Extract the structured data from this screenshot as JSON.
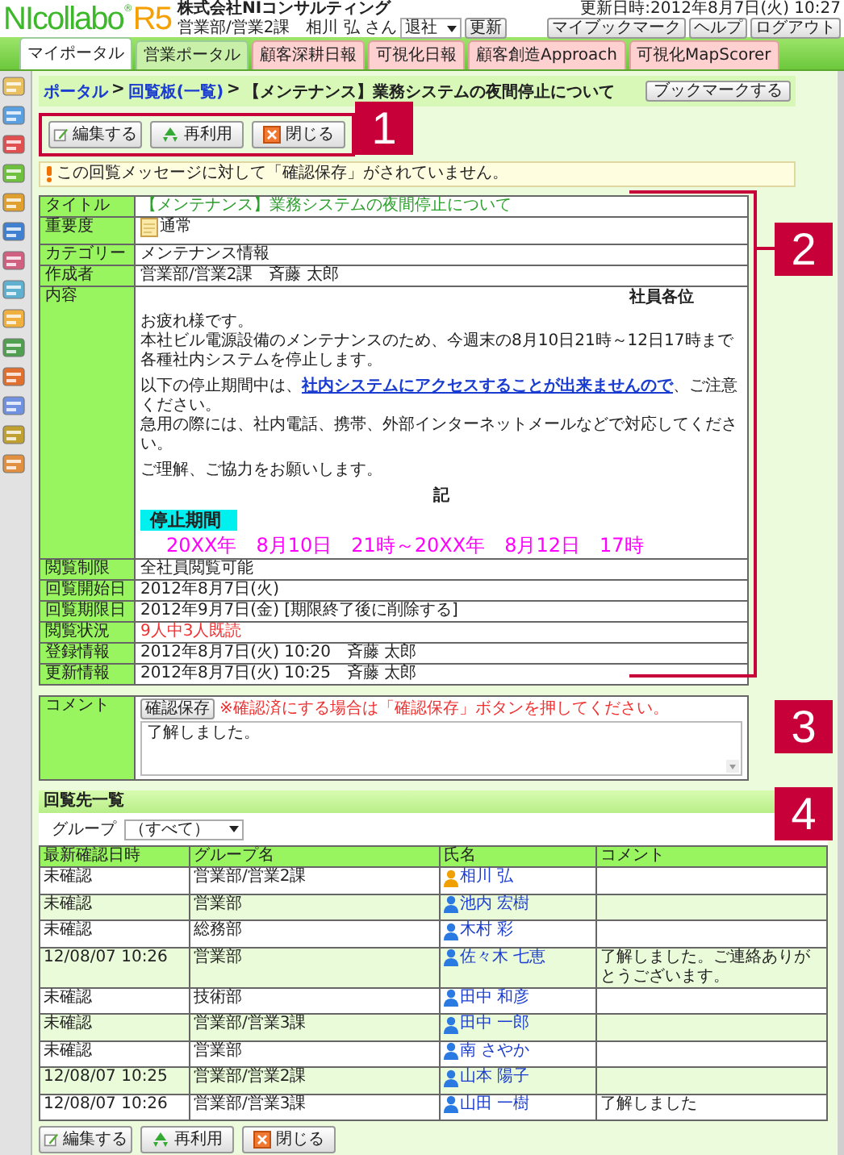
{
  "header": {
    "logo": "NIcollabo",
    "logo_mark": "®",
    "logo_suffix": "R5",
    "company": "株式会社NIコンサルティング",
    "user": "営業部/営業2課　相川 弘 さん",
    "status_select": "退社",
    "update_button": "更新",
    "updated": "更新日時:2012年8月7日(火) 10:27",
    "buttons": [
      "マイブックマーク",
      "ヘルプ",
      "ログアウト"
    ]
  },
  "tabs": [
    {
      "label": "マイポータル",
      "selected": true,
      "kind": "portal"
    },
    {
      "label": "営業ポータル",
      "selected": false,
      "kind": "portal"
    },
    {
      "label": "顧客深耕日報",
      "selected": false,
      "kind": "addon"
    },
    {
      "label": "可視化日報",
      "selected": false,
      "kind": "addon"
    },
    {
      "label": "顧客創造Approach",
      "selected": false,
      "kind": "addon"
    },
    {
      "label": "可視化MapScorer",
      "selected": false,
      "kind": "addon"
    }
  ],
  "breadcrumb": {
    "separator": ">",
    "items": [
      {
        "text": "ポータル",
        "link": true
      },
      {
        "text": "回覧板(一覧)",
        "link": true
      },
      {
        "text": "【メンテナンス】業務システムの夜間停止について",
        "link": false
      }
    ],
    "bookmark_button": "ブックマークする"
  },
  "toolbar": [
    {
      "label": "編集する",
      "kind": "edit"
    },
    {
      "label": "再利用",
      "kind": "reuse"
    },
    {
      "label": "閉じる",
      "kind": "close"
    }
  ],
  "notice": "この回覧メッセージに対して「確認保存」がされていません。",
  "details": [
    {
      "label": "タイトル",
      "value": "【メンテナンス】業務システムの夜間停止について",
      "kind": "title"
    },
    {
      "label": "重要度",
      "value": "通常",
      "kind": "priority"
    },
    {
      "label": "カテゴリー",
      "value": "メンテナンス情報",
      "kind": "text"
    },
    {
      "label": "作成者",
      "value": "営業部/営業2課　斉藤 太郎",
      "kind": "text"
    },
    {
      "label": "内容",
      "kind": "content"
    },
    {
      "label": "閲覧制限",
      "value": "全社員閲覧可能",
      "kind": "text"
    },
    {
      "label": "回覧開始日",
      "value": "2012年8月7日(火)",
      "kind": "text"
    },
    {
      "label": "回覧期限日",
      "value": "2012年9月7日(金) [期限終了後に削除する]",
      "kind": "text"
    },
    {
      "label": "閲覧状況",
      "value": "9人中3人既読",
      "kind": "alert"
    },
    {
      "label": "登録情報",
      "value": "2012年8月7日(火) 10:20　斉藤 太郎",
      "kind": "text"
    },
    {
      "label": "更新情報",
      "value": "2012年8月7日(火) 10:25　斉藤 太郎",
      "kind": "text"
    }
  ],
  "content": [
    {
      "kind": "right",
      "text": "社員各位"
    },
    {
      "kind": "text",
      "lines": [
        "お疲れ様です。",
        "本社ビル電源設備のメンテナンスのため、今週末の8月10日21時～12日17時まで",
        "各種社内システムを停止します。"
      ]
    },
    {
      "kind": "link",
      "before": "以下の停止期間中は、",
      "link": "社内システムにアクセスすることが出来ませんので",
      "after": "、ご注意ください。",
      "lines": [
        "急用の際には、社内電話、携帯、外部インターネットメールなどで対応してください。"
      ]
    },
    {
      "kind": "text",
      "lines": [
        "ご理解、ご協力をお願いします。"
      ]
    },
    {
      "kind": "center",
      "text": "記"
    },
    {
      "kind": "heading",
      "text": "停止期間"
    },
    {
      "kind": "period",
      "text": "20XX年　8月10日　21時～20XX年　8月12日　17時"
    }
  ],
  "comment": {
    "label": "コメント",
    "button": "確認保存",
    "note": "※確認済にする場合は「確認保存」ボタンを押してください。",
    "value": "了解しました。"
  },
  "recipients": {
    "title": "回覧先一覧",
    "group_label": "グループ",
    "group_select": "（すべて）",
    "columns": [
      "最新確認日時",
      "グループ名",
      "氏名",
      "コメント"
    ],
    "rows": [
      {
        "date": "未確認",
        "group": "営業部/営業2課",
        "name": "相川 弘",
        "color": "#f0a000",
        "comment": ""
      },
      {
        "date": "未確認",
        "group": "営業部",
        "name": "池内 宏樹",
        "color": "#2a7ae2",
        "comment": ""
      },
      {
        "date": "未確認",
        "group": "総務部",
        "name": "木村 彩",
        "color": "#2a7ae2",
        "comment": ""
      },
      {
        "date": "12/08/07 10:26",
        "group": "営業部",
        "name": "佐々木 七恵",
        "color": "#2a7ae2",
        "comment": "了解しました。ご連絡ありがとうございます。"
      },
      {
        "date": "未確認",
        "group": "技術部",
        "name": "田中 和彦",
        "color": "#2a7ae2",
        "comment": ""
      },
      {
        "date": "未確認",
        "group": "営業部/営業3課",
        "name": "田中 一郎",
        "color": "#2a7ae2",
        "comment": ""
      },
      {
        "date": "未確認",
        "group": "営業部",
        "name": "南 さやか",
        "color": "#2a7ae2",
        "comment": ""
      },
      {
        "date": "12/08/07 10:25",
        "group": "営業部/営業2課",
        "name": "山本 陽子",
        "color": "#2a7ae2",
        "comment": ""
      },
      {
        "date": "12/08/07 10:26",
        "group": "営業部/営業3課",
        "name": "山田 一樹",
        "color": "#2a7ae2",
        "comment": "了解しました"
      }
    ]
  },
  "bottom_toolbar": [
    {
      "label": "編集する",
      "kind": "edit"
    },
    {
      "label": "再利用",
      "kind": "reuse"
    },
    {
      "label": "閉じる",
      "kind": "close"
    }
  ],
  "callouts": [
    "1",
    "2",
    "3",
    "4"
  ]
}
